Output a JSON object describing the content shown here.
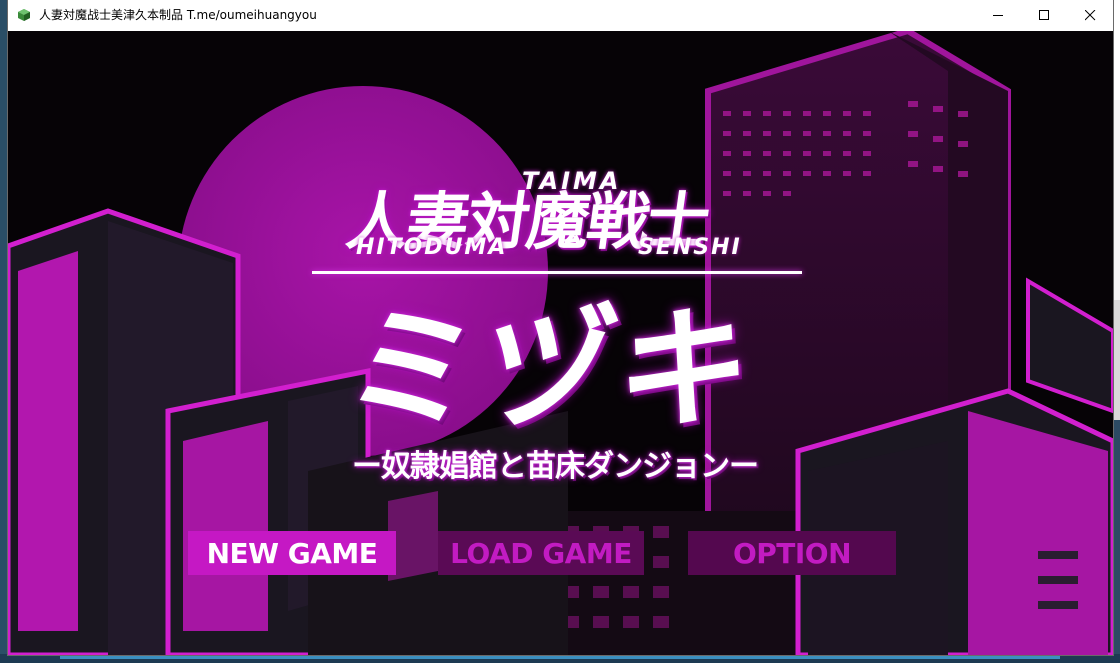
{
  "window": {
    "title": "人妻対魔战士美津久本制品 T.me/oumeihuangyou",
    "controls": [
      "minimize",
      "maximize",
      "close"
    ]
  },
  "logo": {
    "kanji_top": "人妻対魔戦士",
    "taima": "TAIMA",
    "hitoduma": "HITODUMA",
    "senshi": "SENSHI",
    "mizuki": "ミヅキ",
    "subtitle": "ー奴隷娼館と苗床ダンジョンー"
  },
  "menu": {
    "new_game": "NEW GAME",
    "load_game": "LOAD GAME",
    "option": "OPTION"
  },
  "colors": {
    "accent": "#c518c4",
    "dark_button": "#54084f",
    "moon": "#9c109c",
    "building_dark": "#1a1620",
    "neon": "#c51dc4"
  }
}
